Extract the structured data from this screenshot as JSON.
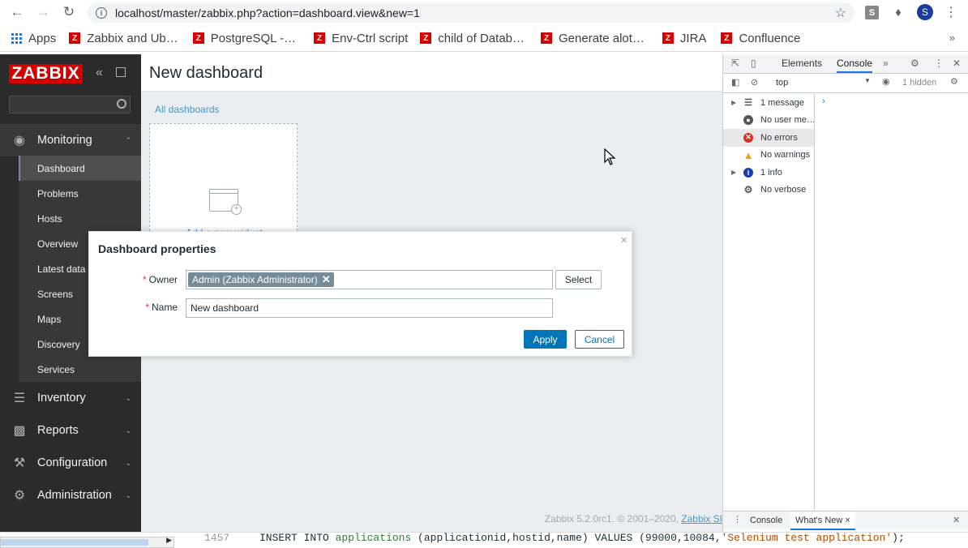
{
  "browser": {
    "url": "localhost/master/zabbix.php?action=dashboard.view&new=1",
    "profile_initial": "S",
    "extension_initial": "S",
    "bookmarks": [
      "Apps",
      "Zabbix and Ub…",
      "PostgreSQL -…",
      "Env-Ctrl script",
      "child of Datab…",
      "Generate alot…",
      "JIRA",
      "Confluence"
    ]
  },
  "sidebar": {
    "logo": "ZABBIX",
    "sections": {
      "monitoring": "Monitoring",
      "inventory": "Inventory",
      "reports": "Reports",
      "configuration": "Configuration",
      "administration": "Administration"
    },
    "monitoring_items": [
      "Dashboard",
      "Problems",
      "Hosts",
      "Overview",
      "Latest data",
      "Screens",
      "Maps",
      "Discovery",
      "Services"
    ],
    "active_item": "Dashboard"
  },
  "main": {
    "title": "New dashboard",
    "breadcrumb": "All dashboards",
    "add_widget": "Add a new widget",
    "footer_version": "Zabbix 5.2.0rc1. © 2001–2020,",
    "footer_link": "Zabbix SI"
  },
  "dialog": {
    "title": "Dashboard properties",
    "owner_label": "Owner",
    "owner_value": "Admin (Zabbix Administrator)",
    "select_label": "Select",
    "name_label": "Name",
    "name_value": "New dashboard",
    "apply_label": "Apply",
    "cancel_label": "Cancel"
  },
  "devtools": {
    "tabs": {
      "elements": "Elements",
      "console": "Console"
    },
    "context": "top",
    "hidden": "1 hidden",
    "sidebar_items": [
      "1 message",
      "No user me…",
      "No errors",
      "No warnings",
      "1 info",
      "No verbose"
    ],
    "drawer_tabs": {
      "console": "Console",
      "whats_new": "What's New"
    }
  },
  "editor": {
    "line_number": "1457",
    "sql_kw1": "INSERT INTO ",
    "sql_table": "applications",
    "sql_mid": " (applicationid,hostid,name) VALUES (99000,10084,",
    "sql_str": "'Selenium test application'",
    "sql_end": ");"
  },
  "colors": {
    "zabbix_red": "#d40000",
    "sidebar_bg": "#2b2b2b",
    "link_blue": "#4796c4",
    "apply_blue": "#0275b8",
    "error_red": "#e33734"
  }
}
